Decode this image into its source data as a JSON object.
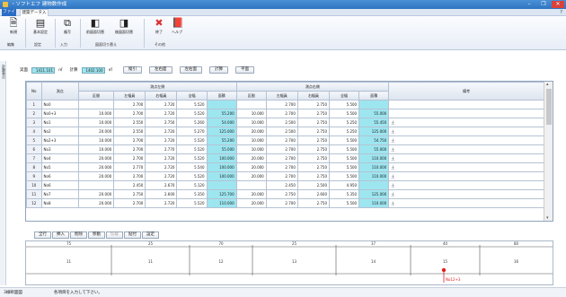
{
  "window": {
    "title": "・ソフトエフ 建物数作成",
    "buttons": [
      "–",
      "❐",
      "✕"
    ]
  },
  "ribbon_tabs": {
    "file": "ファイル",
    "active": "建築データ入力",
    "help_symbol": "?"
  },
  "ribbon": {
    "buttons": [
      {
        "label": "新規",
        "icon": "new-file-icon",
        "glyph": "🗎"
      },
      {
        "label": "基本設定",
        "icon": "basic-settings-icon",
        "glyph": "▤"
      },
      {
        "label": "複写",
        "icon": "copy-icon",
        "glyph": "⧉"
      },
      {
        "label": "前図面切替",
        "icon": "prev-drawing-icon",
        "glyph": "◧"
      },
      {
        "label": "後図面切替",
        "icon": "next-drawing-icon",
        "glyph": "◨"
      },
      {
        "label": "終了",
        "icon": "exit-icon",
        "glyph": "✖"
      },
      {
        "label": "ヘルプ",
        "icon": "help-book-icon",
        "glyph": "📕"
      }
    ],
    "groups": [
      "編集",
      "設定",
      "入力",
      "図面切り替え",
      "その他"
    ]
  },
  "sidebar": {
    "label": "計算表示"
  },
  "totals": {
    "label1": "実面",
    "value1": "1411.101",
    "unit1": "㎡",
    "label2": "計算",
    "value2": "1402.100",
    "unit2": "㎡",
    "buttons": [
      "縦引",
      "左右面",
      "左右面",
      "計算",
      "平面"
    ]
  },
  "grid": {
    "header_top": [
      "No",
      "測点",
      "測点左側",
      "測点右側",
      "備考"
    ],
    "header_sub": [
      "区間",
      "左幅員",
      "右幅員",
      "全幅",
      "面積",
      "区間",
      "左幅員",
      "右幅員",
      "全幅",
      "面積"
    ],
    "rows": [
      [
        "1",
        "No0",
        "",
        "2.700",
        "2.720",
        "5.520",
        "",
        "",
        "2.700",
        "2.750",
        "5.500",
        "",
        ""
      ],
      [
        "2",
        "No0+3",
        "10.000",
        "2.700",
        "2.720",
        "5.520",
        "55.200",
        "10.000",
        "2.700",
        "2.750",
        "5.500",
        "55.000",
        ""
      ],
      [
        "3",
        "No1",
        "10.000",
        "2.550",
        "2.750",
        "5.260",
        "54.000",
        "10.000",
        "2.500",
        "2.750",
        "5.250",
        "55.450",
        "土"
      ],
      [
        "4",
        "No2",
        "20.000",
        "2.550",
        "2.720",
        "5.270",
        "125.000",
        "20.000",
        "2.500",
        "2.750",
        "5.250",
        "125.000",
        "土"
      ],
      [
        "5",
        "No2+3",
        "10.000",
        "2.700",
        "2.720",
        "5.520",
        "55.200",
        "10.000",
        "2.700",
        "2.750",
        "5.500",
        "54.750",
        "土"
      ],
      [
        "6",
        "No3",
        "10.000",
        "2.700",
        "2.770",
        "5.520",
        "55.000",
        "10.000",
        "2.700",
        "2.750",
        "5.500",
        "55.000",
        "土"
      ],
      [
        "7",
        "No4",
        "20.000",
        "2.700",
        "2.720",
        "5.520",
        "100.000",
        "20.000",
        "2.700",
        "2.750",
        "5.500",
        "110.000",
        "土"
      ],
      [
        "8",
        "No5",
        "20.000",
        "2.770",
        "2.720",
        "5.540",
        "100.000",
        "20.000",
        "2.700",
        "2.750",
        "5.500",
        "110.000",
        "土"
      ],
      [
        "9",
        "No6",
        "20.000",
        "2.700",
        "2.720",
        "5.520",
        "100.000",
        "20.000",
        "2.700",
        "2.750",
        "5.500",
        "110.000",
        "土"
      ],
      [
        "10",
        "No6",
        "",
        "2.450",
        "2.670",
        "5.120",
        "",
        "",
        "2.450",
        "2.500",
        "4.950",
        "",
        "土"
      ],
      [
        "11",
        "No7",
        "20.000",
        "2.750",
        "2.600",
        "5.350",
        "125.700",
        "20.000",
        "2.750",
        "2.600",
        "5.350",
        "125.000",
        "土"
      ],
      [
        "12",
        "No8",
        "20.000",
        "2.700",
        "2.720",
        "5.520",
        "110.000",
        "20.000",
        "2.700",
        "2.750",
        "5.500",
        "110.000",
        "土"
      ]
    ]
  },
  "bottom_buttons": [
    "全行",
    "挿入",
    "削除",
    "移動",
    "切取",
    "貼付",
    "設定"
  ],
  "diagram": {
    "top_labels": [
      "75",
      "25",
      "70",
      "25",
      "37",
      "40",
      "80"
    ],
    "mid_labels": [
      "11",
      "11",
      "12",
      "13",
      "14",
      "15",
      "16"
    ],
    "marker_label": "No12+3"
  },
  "status": {
    "mode": "3線断面図",
    "message": "各項目を入力して下さい。"
  },
  "colors": {
    "accent": "#2b6cc4",
    "highlight_cyan": "#9de6f0",
    "marker": "#e02020"
  }
}
